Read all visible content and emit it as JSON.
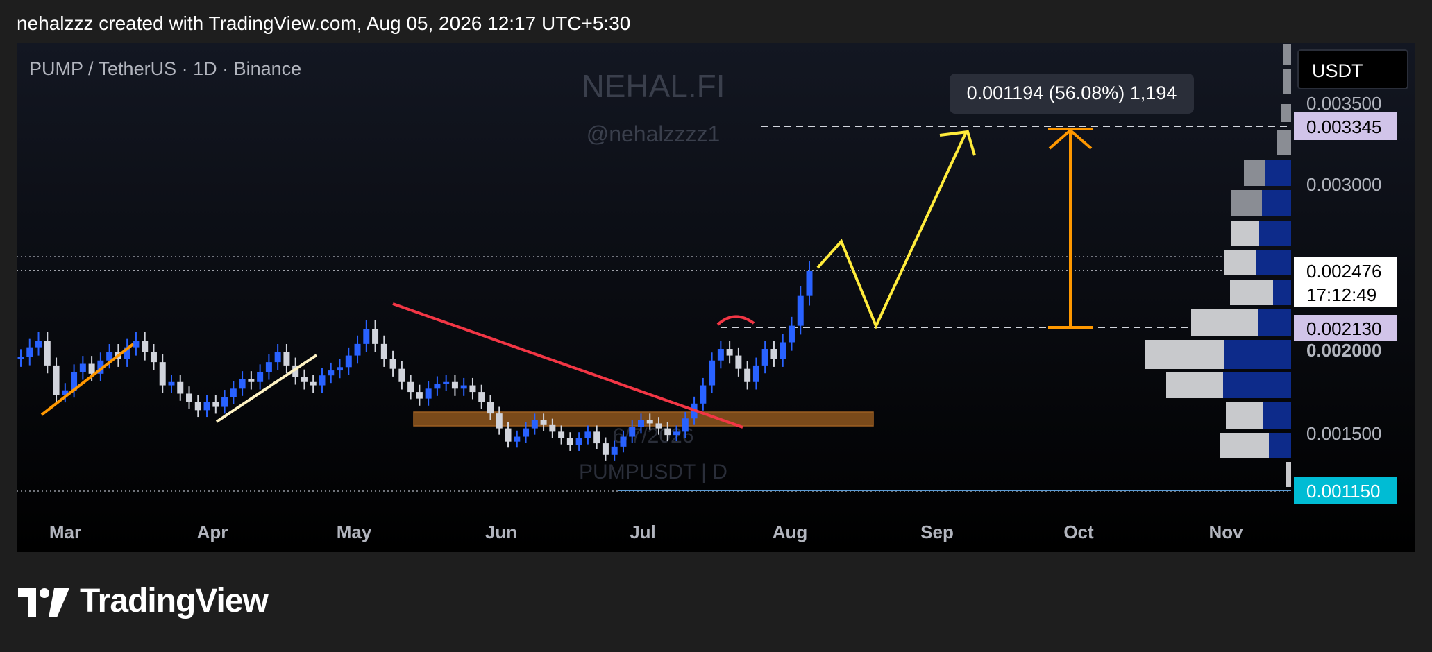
{
  "header": {
    "caption": "nehalzzz created with TradingView.com, Aug 05, 2026 12:17 UTC+5:30"
  },
  "footer": {
    "brand": "TradingView"
  },
  "chart_data": {
    "type": "candlestick",
    "symbol_title": "PUMP / TetherUS · 1D · Binance",
    "currency_button": "USDT",
    "watermark": {
      "name": "NEHAL.FI",
      "handle": "@nehalzzzz1"
    },
    "center_watermark": {
      "date": "6/7/2026",
      "ticker": "PUMPUSDT | D"
    },
    "x_ticks": [
      "Mar",
      "Apr",
      "May",
      "Jun",
      "Jul",
      "Aug",
      "Sep",
      "Oct",
      "Nov"
    ],
    "y_ticks": [
      "0.003500",
      "0.003000",
      "0.002000",
      "0.001500"
    ],
    "y_range": [
      0.00108,
      0.00365
    ],
    "price_labels": {
      "target": "0.003345",
      "current": "0.002476",
      "countdown": "17:12:49",
      "entry": "0.002130",
      "low": "0.001150"
    },
    "measure_label": "0.001194 (56.08%) 1,194",
    "candles_approx_close": [
      0.00195,
      0.00201,
      0.00205,
      0.0019,
      0.00172,
      0.00175,
      0.00186,
      0.00191,
      0.00185,
      0.00193,
      0.00198,
      0.00194,
      0.00201,
      0.00205,
      0.00198,
      0.00192,
      0.00178,
      0.0018,
      0.00173,
      0.00168,
      0.00163,
      0.00168,
      0.00165,
      0.00171,
      0.00176,
      0.00182,
      0.0018,
      0.00186,
      0.00192,
      0.00198,
      0.0019,
      0.00183,
      0.0018,
      0.00178,
      0.00184,
      0.00187,
      0.00189,
      0.00196,
      0.00203,
      0.00212,
      0.00203,
      0.00194,
      0.00188,
      0.0018,
      0.00174,
      0.0017,
      0.00176,
      0.00179,
      0.0018,
      0.00176,
      0.00178,
      0.00174,
      0.00168,
      0.00161,
      0.00152,
      0.00144,
      0.00147,
      0.00152,
      0.00157,
      0.00154,
      0.0015,
      0.00146,
      0.00142,
      0.00146,
      0.0015,
      0.00143,
      0.00136,
      0.00141,
      0.00147,
      0.00153,
      0.00157,
      0.00155,
      0.00152,
      0.00148,
      0.0015,
      0.00158,
      0.00167,
      0.00178,
      0.00193,
      0.002,
      0.00196,
      0.00188,
      0.0018,
      0.0019,
      0.002,
      0.00194,
      0.00204,
      0.00214,
      0.00232,
      0.00247
    ],
    "volume_profile_note": "horizontal volume profile on right edge, blue (up) and gray (down) bars"
  },
  "colors": {
    "background": "#000000",
    "bull": "#2962ff",
    "bear": "#d1d4dc",
    "trendline": "#f23645",
    "zone": "#7a4a1a",
    "projection": "#ffeb3b",
    "measure": "#ff9800",
    "target_label": "#d1c4e9",
    "low_label": "#00bcd4"
  }
}
